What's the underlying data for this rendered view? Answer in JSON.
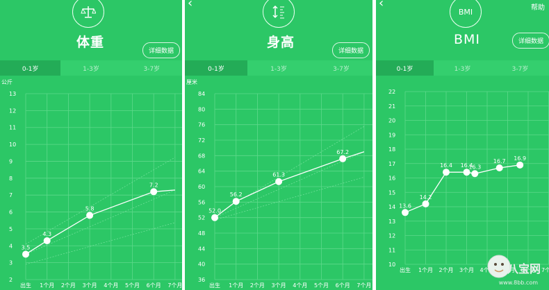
{
  "panels": [
    {
      "title": "体重",
      "icon": "scale-icon",
      "detail_label": "详细数据",
      "tabs": [
        "0-1岁",
        "1-3岁",
        "3-7岁"
      ],
      "active_tab": 0,
      "unit": "公斤"
    },
    {
      "title": "身高",
      "icon": "height-ruler-icon",
      "icon_text": "",
      "detail_label": "详细数据",
      "tabs": [
        "0-1岁",
        "1-3岁",
        "3-7岁"
      ],
      "active_tab": 0,
      "unit": "厘米"
    },
    {
      "title": "BMI",
      "icon": "bmi-icon",
      "icon_text": "BMI",
      "detail_label": "详细数据",
      "help_label": "帮助",
      "tabs": [
        "0-1岁",
        "1-3岁",
        "3-7岁"
      ],
      "active_tab": 0,
      "unit": ""
    }
  ],
  "watermark": {
    "text": "八宝网",
    "url": "www.8bb.com"
  },
  "chart_data": [
    {
      "type": "line",
      "title": "体重",
      "ylabel": "公斤",
      "categories": [
        "出生",
        "1个月",
        "2个月",
        "3个月",
        "4个月",
        "5个月",
        "6个月",
        "7个月"
      ],
      "ylim": [
        2,
        13
      ],
      "yticks": [
        2,
        3,
        4,
        5,
        6,
        7,
        8,
        9,
        10,
        11,
        12,
        13
      ],
      "series": [
        {
          "x": [
            0,
            1,
            3,
            6,
            7
          ],
          "values": [
            3.5,
            4.3,
            5.8,
            7.2,
            7.3
          ],
          "labels": [
            "3.5",
            "4.3",
            "5.8",
            "7.2",
            ""
          ]
        }
      ],
      "grid": true
    },
    {
      "type": "line",
      "title": "身高",
      "ylabel": "厘米",
      "categories": [
        "出生",
        "1个月",
        "2个月",
        "3个月",
        "4个月",
        "5个月",
        "6个月",
        "7个月"
      ],
      "ylim": [
        36,
        84
      ],
      "yticks": [
        36,
        40,
        44,
        48,
        52,
        56,
        60,
        64,
        68,
        72,
        76,
        80,
        84
      ],
      "series": [
        {
          "x": [
            0,
            1,
            3,
            6,
            7
          ],
          "values": [
            52.0,
            56.2,
            61.3,
            67.2,
            69.0
          ],
          "labels": [
            "52.0",
            "56.2",
            "61.3",
            "67.2",
            ""
          ]
        }
      ],
      "grid": true
    },
    {
      "type": "line",
      "title": "BMI",
      "ylabel": "",
      "categories": [
        "出生",
        "1个月",
        "2个月",
        "3个月",
        "4个月",
        "5个月",
        "6个月",
        "7个月"
      ],
      "ylim": [
        10,
        22
      ],
      "yticks": [
        10,
        11,
        12,
        13,
        14,
        15,
        16,
        17,
        18,
        19,
        20,
        21,
        22
      ],
      "series": [
        {
          "x": [
            0,
            1,
            2,
            3,
            3.4,
            4.6,
            5.6
          ],
          "values": [
            13.6,
            14.2,
            16.4,
            16.4,
            16.3,
            16.7,
            16.9
          ],
          "labels": [
            "13.6",
            "14.2",
            "16.4",
            "16.4",
            "16.3",
            "16.7",
            "16.9"
          ]
        }
      ],
      "grid": true
    }
  ]
}
